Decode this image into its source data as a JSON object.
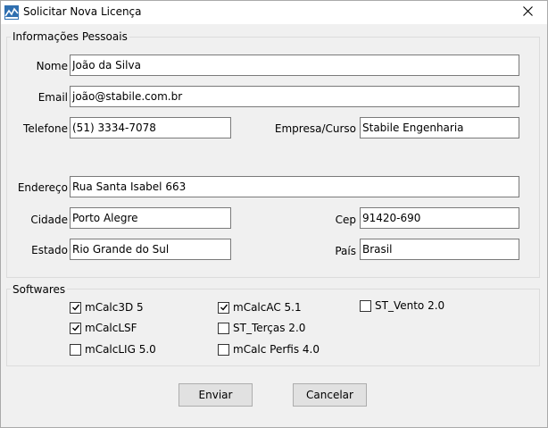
{
  "window": {
    "title": "Solicitar Nova Licença"
  },
  "personal": {
    "legend": "Informações Pessoais",
    "nome": {
      "label": "Nome",
      "value": "João da Silva"
    },
    "email": {
      "label": "Email",
      "value": "joão@stabile.com.br"
    },
    "telefone": {
      "label": "Telefone",
      "value": "(51) 3334-7078"
    },
    "empresa": {
      "label": "Empresa/Curso",
      "value": "Stabile Engenharia"
    },
    "endereco": {
      "label": "Endereço",
      "value": "Rua Santa Isabel 663"
    },
    "cidade": {
      "label": "Cidade",
      "value": "Porto Alegre"
    },
    "cep": {
      "label": "Cep",
      "value": "91420-690"
    },
    "estado": {
      "label": "Estado",
      "value": "Rio Grande do Sul"
    },
    "pais": {
      "label": "País",
      "value": "Brasil"
    }
  },
  "softwares": {
    "legend": "Softwares",
    "items": [
      {
        "label": "mCalc3D 5",
        "checked": true
      },
      {
        "label": "mCalcAC 5.1",
        "checked": true
      },
      {
        "label": "ST_Vento 2.0",
        "checked": false
      },
      {
        "label": "mCalcLSF",
        "checked": true
      },
      {
        "label": "ST_Terças 2.0",
        "checked": false
      },
      {
        "label": "mCalcLIG 5.0",
        "checked": false
      },
      {
        "label": "mCalc Perfis 4.0",
        "checked": false
      }
    ]
  },
  "buttons": {
    "enviar": "Enviar",
    "cancelar": "Cancelar"
  },
  "icons": {
    "app": "app-icon",
    "close": "close-icon",
    "check": "checkmark-icon"
  },
  "colors": {
    "window_bg": "#f0f0f0",
    "titlebar_bg": "#ffffff",
    "button_bg": "#e1e1e1",
    "field_border": "#7a7a7a"
  }
}
